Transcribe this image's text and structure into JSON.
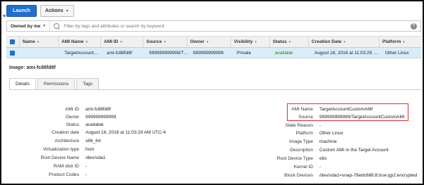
{
  "toolbar": {
    "launch_label": "Launch",
    "actions_label": "Actions"
  },
  "filter": {
    "owned_label": "Owned by me",
    "search_placeholder": "Filter by tags and attributes or search by keyword",
    "help_glyph": "?"
  },
  "table": {
    "headers": [
      "Name",
      "AMI Name",
      "AMI ID",
      "Source",
      "Owner",
      "Visibility",
      "Status",
      "Creation Date",
      "Platform"
    ],
    "row": {
      "name": "",
      "ami_name": "TargetAccount…",
      "ami_id": "ami-fc88fd8f",
      "source": "999999999999/T…",
      "owner": "999999999999",
      "visibility": "Private",
      "status": "available",
      "creation_date": "August 16, 2016 at 11:03:29 …",
      "platform": "Other Linux"
    },
    "status_color": "#1d8102",
    "selected_row_color": "#d9edf9"
  },
  "details": {
    "title": "Image: ami-fc88fd8f",
    "tabs": [
      "Details",
      "Permissions",
      "Tags"
    ],
    "left": [
      {
        "label": "AMI ID",
        "value": "ami-fc88fd8f"
      },
      {
        "label": "Owner",
        "value": "999999999999"
      },
      {
        "label": "Status",
        "value": "available"
      },
      {
        "label": "Creation date",
        "value": "August 16, 2016 at 11:03:29 AM UTC-4"
      },
      {
        "label": "Architecture",
        "value": "x86_64"
      },
      {
        "label": "Virtualization type",
        "value": "hvm"
      },
      {
        "label": "Root Device Name",
        "value": "/dev/sda1"
      },
      {
        "label": "RAM disk ID",
        "value": "-"
      },
      {
        "label": "Product Codes",
        "value": "-"
      }
    ],
    "right": [
      {
        "label": "AMI Name",
        "value": "TargetAccountCustomAMI"
      },
      {
        "label": "Source",
        "value": "999999999999/TargetAccountCustomAMI"
      },
      {
        "label": "State Reason",
        "value": "-"
      },
      {
        "label": "Platform",
        "value": "Other Linux"
      },
      {
        "label": "Image Type",
        "value": "machine"
      },
      {
        "label": "Description",
        "value": "Custom AMI in the Target Account"
      },
      {
        "label": "Root Device Type",
        "value": "ebs"
      },
      {
        "label": "Kernel ID",
        "value": "-"
      },
      {
        "label": "Block Devices",
        "value": "/dev/sda1=snap-78edc688:8:true:gp2:encrypted"
      }
    ],
    "highlight_color": "#e0292e"
  }
}
